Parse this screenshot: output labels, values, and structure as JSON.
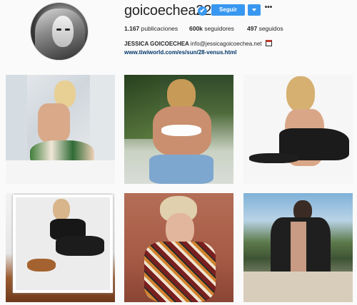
{
  "profile": {
    "username": "goicoechea22",
    "verified_badge": "✔",
    "follow_label": "Seguir",
    "more_label": "•••",
    "stats": {
      "posts_count": "1.167",
      "posts_label": "publicaciones",
      "followers_count": "600k",
      "followers_label": "seguidores",
      "following_count": "497",
      "following_label": "seguidos"
    },
    "full_name": "JESSICA GOICOECHEA",
    "email": "info@jessicagoicoechea.net",
    "website": "www.tiwiworld.com/es/sun/28-venus.html"
  },
  "colors": {
    "accent": "#3897f0",
    "text": "#262626",
    "link": "#003569",
    "background": "#fafafa"
  },
  "icons": {
    "verified": "verified-badge-icon",
    "dropdown": "chevron-down-icon",
    "more": "more-options-icon",
    "calendar": "calendar-icon"
  },
  "posts": [
    {
      "alt": "post-1"
    },
    {
      "alt": "post-2"
    },
    {
      "alt": "post-3"
    },
    {
      "alt": "post-4"
    },
    {
      "alt": "post-5"
    },
    {
      "alt": "post-6"
    }
  ]
}
